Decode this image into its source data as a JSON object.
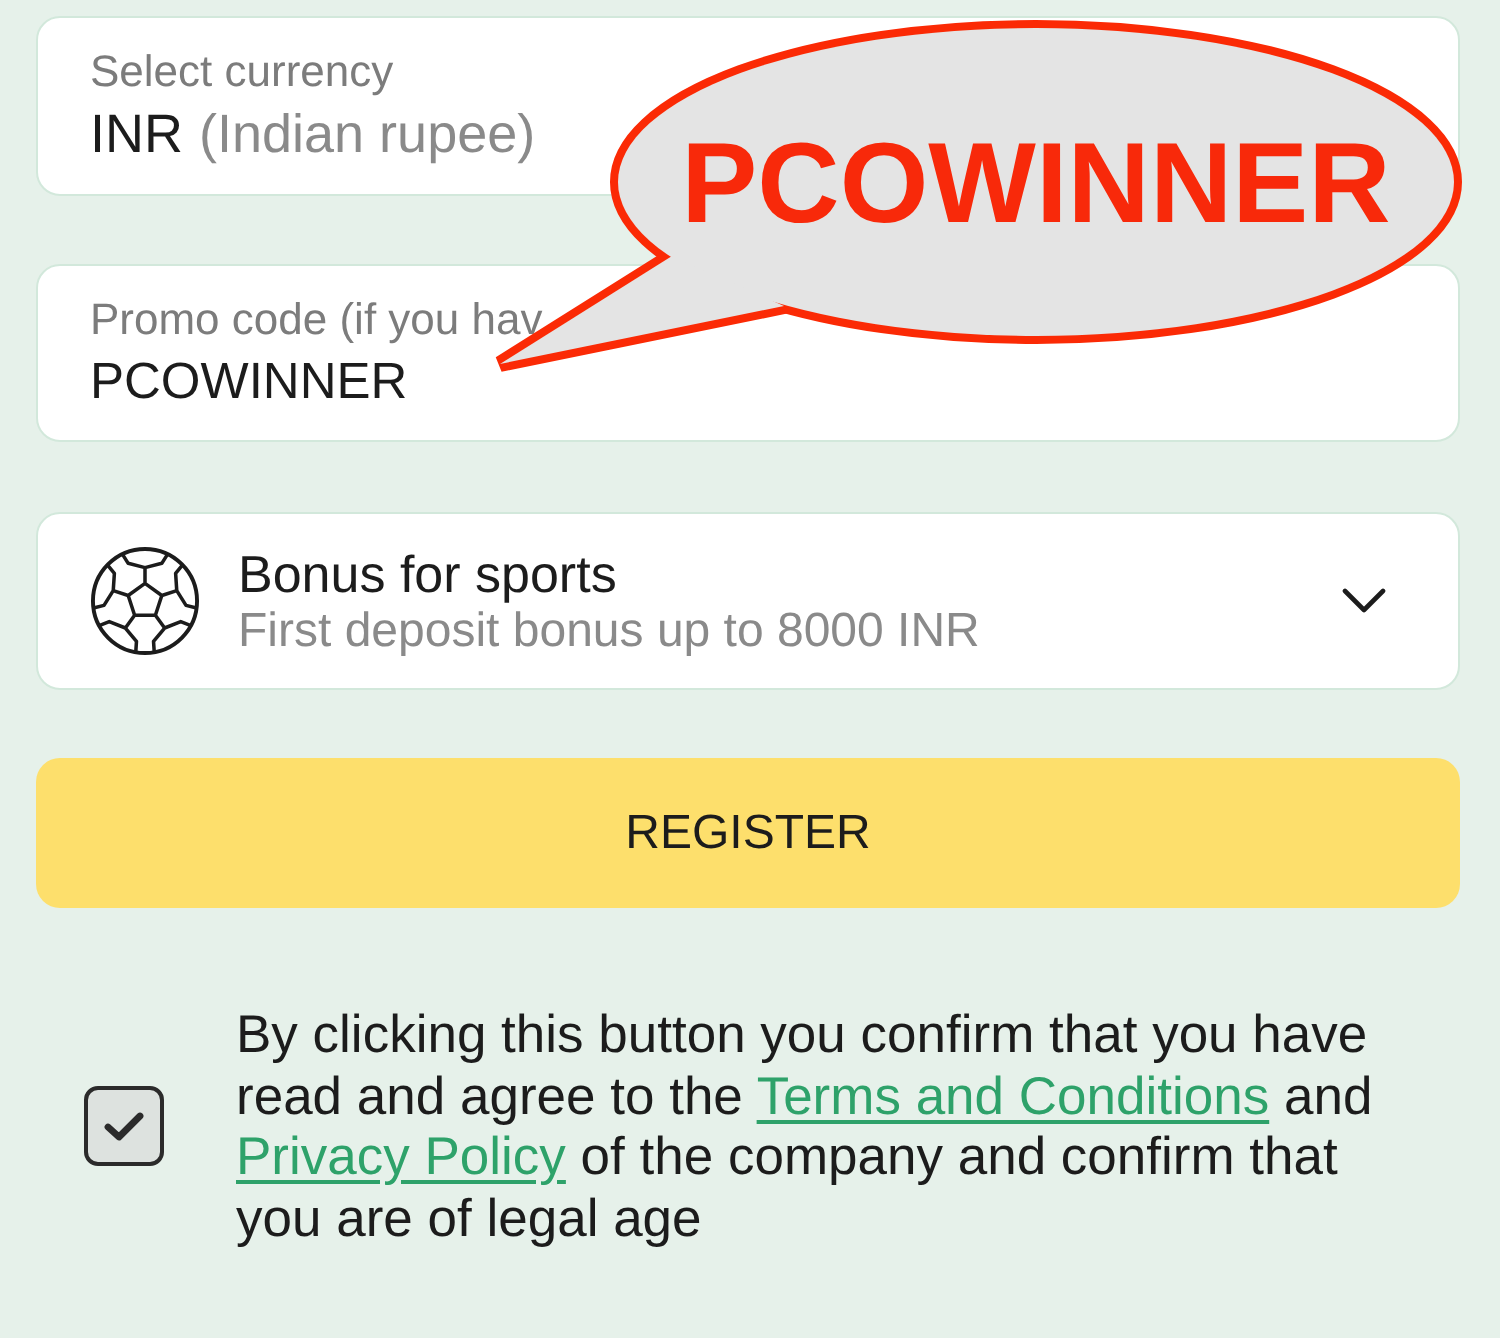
{
  "currency_field": {
    "label": "Select currency",
    "value": "INR",
    "value_note": "(Indian rupee)"
  },
  "promo_field": {
    "label": "Promo code (if you hav",
    "value": "PCOWINNER"
  },
  "bonus_select": {
    "title": "Bonus for sports",
    "subtitle": "First deposit bonus up to 8000 INR"
  },
  "register_button": {
    "label": "REGISTER"
  },
  "consent": {
    "checked": true,
    "parts": [
      {
        "kind": "text",
        "text": "By clicking this button you confirm that you have read and agree to the "
      },
      {
        "kind": "link",
        "text": "Terms and Conditions"
      },
      {
        "kind": "text",
        "text": " and "
      },
      {
        "kind": "link",
        "text": "Privacy Policy"
      },
      {
        "kind": "text",
        "text": " of the company and confirm that you are of legal age"
      }
    ]
  },
  "callout": {
    "text": "PCOWINNER"
  }
}
